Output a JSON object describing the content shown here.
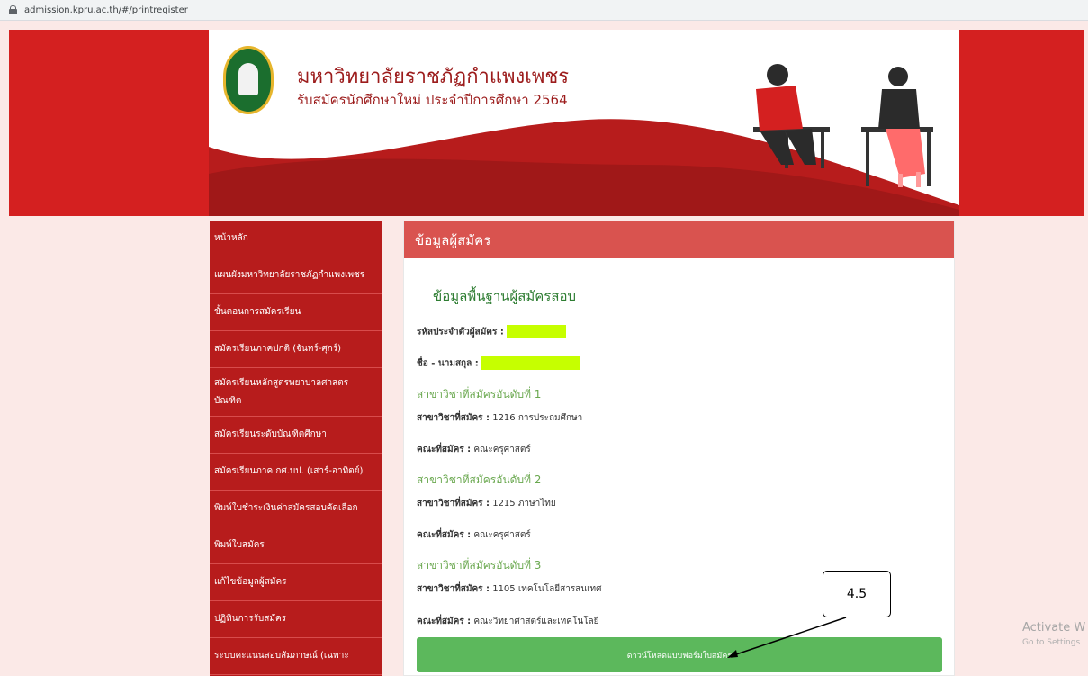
{
  "browser": {
    "url": "admission.kpru.ac.th/#/printregister"
  },
  "banner": {
    "university_name": "มหาวิทยาลัยราชภัฏกำแพงเพชร",
    "subtitle": "รับสมัครนักศึกษาใหม่ ประจำปีการศึกษา 2564"
  },
  "sidebar": {
    "items": [
      {
        "label": "หน้าหลัก"
      },
      {
        "label": "แผนผังมหาวิทยาลัยราชภัฏกำแพงเพชร"
      },
      {
        "label": "ขั้นตอนการสมัครเรียน"
      },
      {
        "label": "สมัครเรียนภาคปกติ (จันทร์-ศุกร์)"
      },
      {
        "label": "สมัครเรียนหลักสูตรพยาบาลศาสตรบัณฑิต"
      },
      {
        "label": "สมัครเรียนระดับบัณฑิตศึกษา"
      },
      {
        "label": "สมัครเรียนภาค กศ.บป. (เสาร์-อาทิตย์)"
      },
      {
        "label": "พิมพ์ใบชำระเงินค่าสมัครสอบคัดเลือก"
      },
      {
        "label": "พิมพ์ใบสมัคร"
      },
      {
        "label": "แก้ไขข้อมูลผู้สมัคร"
      },
      {
        "label": "ปฏิทินการรับสมัคร"
      },
      {
        "label": "ระบบคะแนนสอบสัมภาษณ์ (เฉพาะ"
      }
    ]
  },
  "panel": {
    "header": "ข้อมูลผู้สมัคร",
    "section_title": "ข้อมูลพื้นฐานผู้สมัครสอบ",
    "applicant_id_label": "รหัสประจำตัวผู้สมัคร :",
    "name_label": "ชื่อ - นามสกุล :",
    "major_label": "สาขาวิชาที่สมัคร :",
    "faculty_label": "คณะที่สมัคร :",
    "choices": [
      {
        "title": "สาขาวิชาที่สมัครอันดับที่ 1",
        "major": "1216 การประถมศึกษา",
        "faculty": "คณะครุศาสตร์"
      },
      {
        "title": "สาขาวิชาที่สมัครอันดับที่ 2",
        "major": "1215 ภาษาไทย",
        "faculty": "คณะครุศาสตร์"
      },
      {
        "title": "สาขาวิชาที่สมัครอันดับที่ 3",
        "major": "1105 เทคโนโลยีสารสนเทศ",
        "faculty": "คณะวิทยาศาสตร์และเทคโนโลยี"
      }
    ],
    "download_button": "ดาวน์โหลดแบบฟอร์มใบสมัคร"
  },
  "annotation": {
    "label": "4.5"
  },
  "watermark": {
    "title": "Activate W",
    "subtitle": "Go to Settings"
  },
  "colors": {
    "brand_red": "#d42020",
    "sidebar_red": "#b71c1c",
    "panel_header": "#d9534f",
    "button_green": "#5cb85c",
    "highlight": "#c6ff00"
  }
}
